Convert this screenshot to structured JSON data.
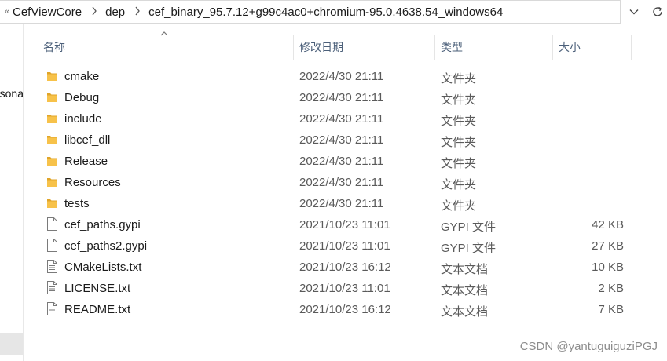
{
  "address": {
    "crumbs": [
      "CefViewCore",
      "dep",
      "cef_binary_95.7.12+g99c4ac0+chromium-95.0.4638.54_windows64"
    ]
  },
  "nav": {
    "partial_text": "sona"
  },
  "columns": {
    "name": "名称",
    "date": "修改日期",
    "type": "类型",
    "size": "大小"
  },
  "files": [
    {
      "name": "cmake",
      "date": "2022/4/30 21:11",
      "type": "文件夹",
      "size": "",
      "kind": "folder"
    },
    {
      "name": "Debug",
      "date": "2022/4/30 21:11",
      "type": "文件夹",
      "size": "",
      "kind": "folder"
    },
    {
      "name": "include",
      "date": "2022/4/30 21:11",
      "type": "文件夹",
      "size": "",
      "kind": "folder"
    },
    {
      "name": "libcef_dll",
      "date": "2022/4/30 21:11",
      "type": "文件夹",
      "size": "",
      "kind": "folder"
    },
    {
      "name": "Release",
      "date": "2022/4/30 21:11",
      "type": "文件夹",
      "size": "",
      "kind": "folder"
    },
    {
      "name": "Resources",
      "date": "2022/4/30 21:11",
      "type": "文件夹",
      "size": "",
      "kind": "folder"
    },
    {
      "name": "tests",
      "date": "2022/4/30 21:11",
      "type": "文件夹",
      "size": "",
      "kind": "folder"
    },
    {
      "name": "cef_paths.gypi",
      "date": "2021/10/23 11:01",
      "type": "GYPI 文件",
      "size": "42 KB",
      "kind": "file"
    },
    {
      "name": "cef_paths2.gypi",
      "date": "2021/10/23 11:01",
      "type": "GYPI 文件",
      "size": "27 KB",
      "kind": "file"
    },
    {
      "name": "CMakeLists.txt",
      "date": "2021/10/23 16:12",
      "type": "文本文档",
      "size": "10 KB",
      "kind": "text"
    },
    {
      "name": "LICENSE.txt",
      "date": "2021/10/23 11:01",
      "type": "文本文档",
      "size": "2 KB",
      "kind": "text"
    },
    {
      "name": "README.txt",
      "date": "2021/10/23 16:12",
      "type": "文本文档",
      "size": "7 KB",
      "kind": "text"
    }
  ],
  "watermark": "CSDN @yantuguiguziPGJ",
  "colors": {
    "folder": "#f7c24a",
    "folder_dark": "#e0a52a",
    "header_text": "#4c607a"
  }
}
